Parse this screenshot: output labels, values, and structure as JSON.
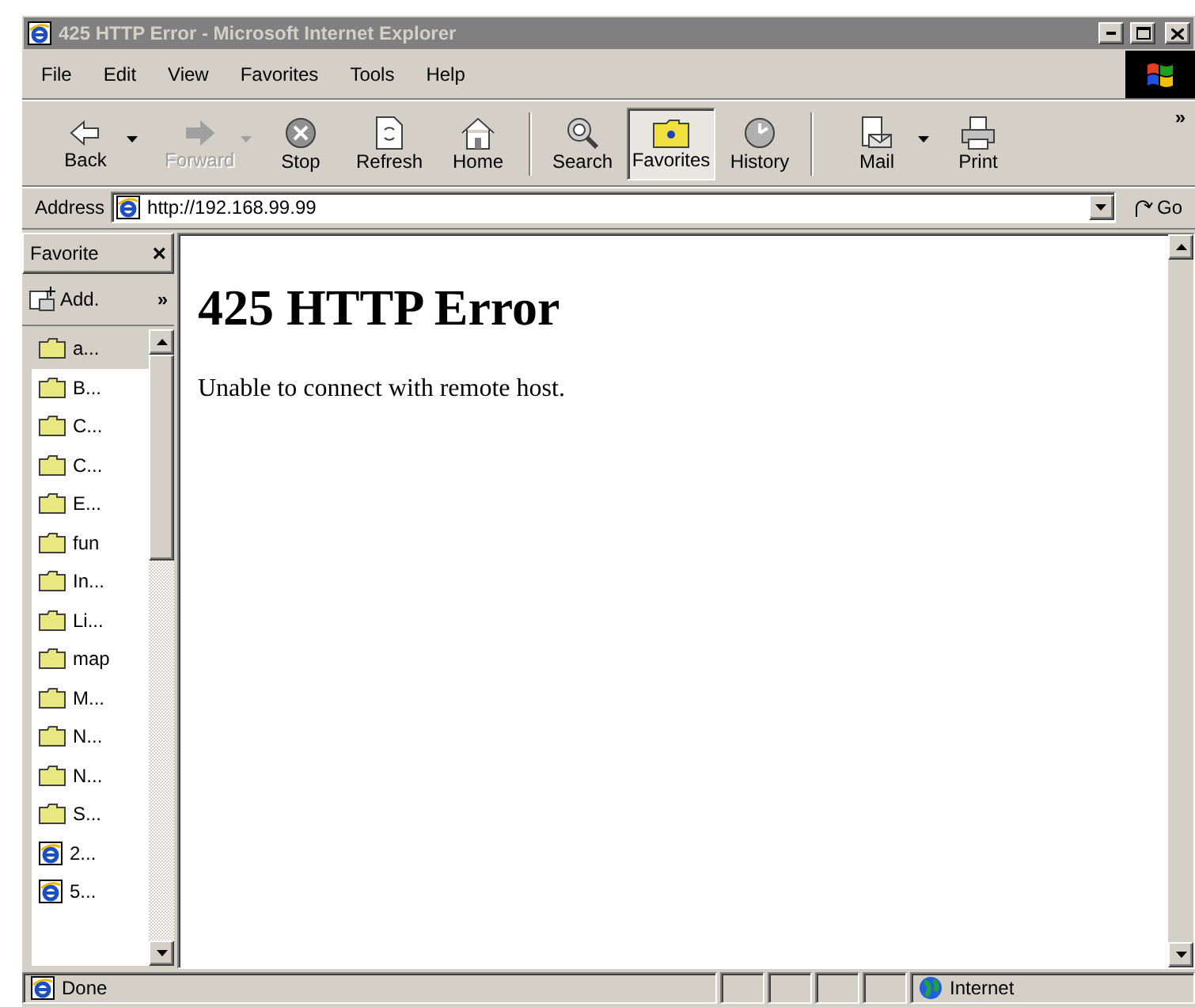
{
  "window": {
    "title": "425 HTTP Error - Microsoft Internet Explorer",
    "active": false
  },
  "menu": [
    {
      "label": "File"
    },
    {
      "label": "Edit"
    },
    {
      "label": "View"
    },
    {
      "label": "Favorites"
    },
    {
      "label": "Tools"
    },
    {
      "label": "Help"
    }
  ],
  "toolbar": [
    {
      "kind": "button",
      "label": "Back",
      "disabled": false,
      "selected": false,
      "dropdown": true
    },
    {
      "kind": "button",
      "label": "Forward",
      "disabled": true,
      "selected": false,
      "dropdown": true
    },
    {
      "kind": "button",
      "label": "Stop",
      "disabled": false,
      "selected": false,
      "dropdown": false
    },
    {
      "kind": "button",
      "label": "Refresh",
      "disabled": false,
      "selected": false,
      "dropdown": false
    },
    {
      "kind": "button",
      "label": "Home",
      "disabled": false,
      "selected": false,
      "dropdown": false
    },
    {
      "kind": "separator"
    },
    {
      "kind": "button",
      "label": "Search",
      "disabled": false,
      "selected": false,
      "dropdown": false
    },
    {
      "kind": "button",
      "label": "Favorites",
      "disabled": false,
      "selected": true,
      "dropdown": false
    },
    {
      "kind": "button",
      "label": "History",
      "disabled": false,
      "selected": false,
      "dropdown": false
    },
    {
      "kind": "separator"
    },
    {
      "kind": "button",
      "label": "Mail",
      "disabled": false,
      "selected": false,
      "dropdown": true
    },
    {
      "kind": "button",
      "label": "Print",
      "disabled": false,
      "selected": false,
      "dropdown": false
    }
  ],
  "toolbar_more": "»",
  "address": {
    "label": "Address",
    "value": "http://192.168.99.99",
    "go": "Go"
  },
  "favorites_pane": {
    "title": "Favorite",
    "close": "×",
    "add": "Add.",
    "more": "»",
    "items": [
      {
        "kind": "folder",
        "label": "a...",
        "selected": true
      },
      {
        "kind": "folder",
        "label": "B...",
        "selected": false
      },
      {
        "kind": "folder",
        "label": "C...",
        "selected": false
      },
      {
        "kind": "folder",
        "label": "C...",
        "selected": false
      },
      {
        "kind": "folder",
        "label": "E...",
        "selected": false
      },
      {
        "kind": "folder",
        "label": "fun",
        "selected": false
      },
      {
        "kind": "folder",
        "label": "In...",
        "selected": false
      },
      {
        "kind": "folder",
        "label": "Li...",
        "selected": false
      },
      {
        "kind": "folder",
        "label": "map",
        "selected": false
      },
      {
        "kind": "folder",
        "label": "M...",
        "selected": false
      },
      {
        "kind": "folder",
        "label": "N...",
        "selected": false
      },
      {
        "kind": "folder",
        "label": "N...",
        "selected": false
      },
      {
        "kind": "folder",
        "label": "S...",
        "selected": false
      },
      {
        "kind": "page",
        "label": "2...",
        "selected": false
      },
      {
        "kind": "page",
        "label": "5...",
        "selected": false
      }
    ]
  },
  "page": {
    "heading": "425 HTTP Error",
    "message": "Unable to connect with remote host."
  },
  "status_bar": {
    "text": "Done",
    "zone": "Internet"
  }
}
